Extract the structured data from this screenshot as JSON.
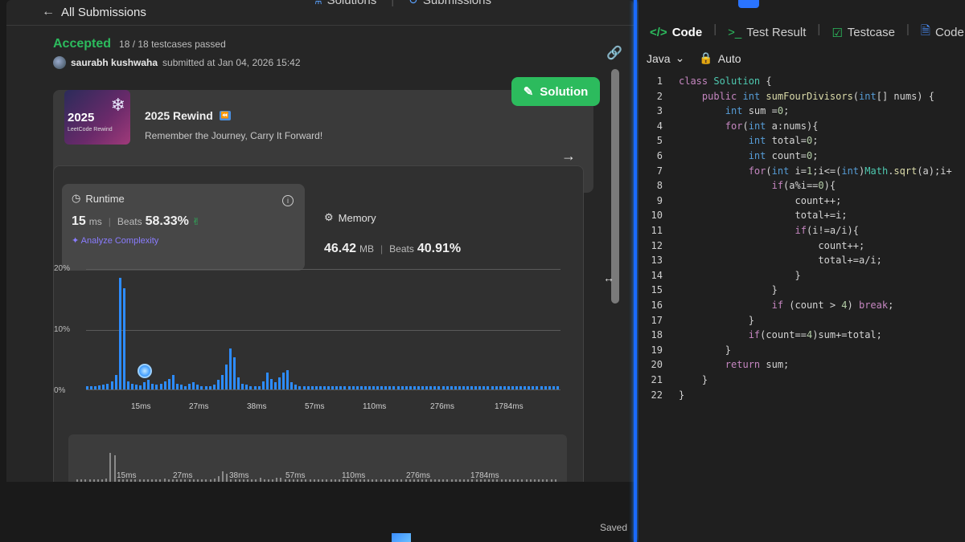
{
  "header": {
    "back_label": "All Submissions",
    "tabs": [
      {
        "label": "Solutions",
        "icon": "flask-icon"
      },
      {
        "label": "Submissions",
        "icon": "history-icon"
      }
    ]
  },
  "submission": {
    "status": "Accepted",
    "testcases": "18 / 18 testcases passed",
    "user": "saurabh kushwaha",
    "submitted_text": "submitted at Jan 04, 2026 15:42",
    "solution_button": "Solution"
  },
  "rewind": {
    "thumb_year": "2025",
    "thumb_sub": "LeetCode Rewind",
    "title": "2025 Rewind",
    "description": "Remember the Journey, Carry It Forward!"
  },
  "runtime": {
    "heading": "Runtime",
    "value": "15",
    "unit": "ms",
    "beats_label": "Beats",
    "beats_value": "58.33%",
    "analyze": "Analyze Complexity"
  },
  "memory": {
    "heading": "Memory",
    "value": "46.42",
    "unit": "MB",
    "beats_label": "Beats",
    "beats_value": "40.91%"
  },
  "chart_data": {
    "type": "bar",
    "title": "",
    "xlabel": "",
    "ylabel": "",
    "ylim": [
      0,
      20
    ],
    "y_ticks": [
      "20%",
      "10%",
      "0%"
    ],
    "x_ticks": [
      "15ms",
      "27ms",
      "38ms",
      "57ms",
      "110ms",
      "276ms",
      "1784ms"
    ],
    "values": [
      0.5,
      0.6,
      0.6,
      0.7,
      0.8,
      1.0,
      1.4,
      2.4,
      18.5,
      16.8,
      1.4,
      1.0,
      0.8,
      0.7,
      1.2,
      1.6,
      1.0,
      0.8,
      1.0,
      1.4,
      1.8,
      2.4,
      1.0,
      0.8,
      0.6,
      0.9,
      1.2,
      0.8,
      0.6,
      0.5,
      0.6,
      0.8,
      1.6,
      2.4,
      4.2,
      6.8,
      5.4,
      2.0,
      1.0,
      0.8,
      0.6,
      0.5,
      0.6,
      1.4,
      2.8,
      1.8,
      1.2,
      2.0,
      2.8,
      3.2,
      1.2,
      0.8,
      0.6,
      0.5,
      0.5,
      0.5,
      0.5,
      0.5,
      0.5,
      0.5,
      0.5,
      0.5,
      0.5,
      0.5,
      0.5,
      0.5,
      0.5,
      0.5,
      0.5,
      0.5,
      0.5,
      0.5,
      0.5,
      0.5,
      0.5,
      0.5,
      0.5,
      0.5,
      0.5,
      0.5,
      0.5,
      0.5,
      0.5,
      0.5,
      0.5,
      0.5,
      0.5,
      0.5,
      0.5,
      0.5,
      0.5,
      0.5,
      0.5,
      0.5,
      0.5,
      0.5,
      0.5,
      0.5,
      0.5,
      0.5,
      0.5,
      0.5,
      0.5,
      0.5,
      0.5,
      0.5,
      0.5,
      0.5,
      0.5,
      0.5,
      0.5,
      0.5,
      0.5,
      0.5,
      0.5,
      0.5
    ],
    "highlight_index": 15
  },
  "overview": {
    "ticks": [
      "15ms",
      "27ms",
      "38ms",
      "57ms",
      "110ms",
      "276ms",
      "1784ms"
    ]
  },
  "editor": {
    "tabs": [
      {
        "label": "Code",
        "icon": "code-icon"
      },
      {
        "label": "Test Result",
        "icon": "terminal-icon"
      },
      {
        "label": "Testcase",
        "icon": "checkbox-icon"
      },
      {
        "label": "Code Sample",
        "icon": "doc-icon"
      }
    ],
    "language": "Java",
    "mode": "Auto",
    "saved": "Saved",
    "line_numbers": [
      "1",
      "2",
      "3",
      "4",
      "5",
      "6",
      "7",
      "8",
      "9",
      "10",
      "11",
      "12",
      "13",
      "14",
      "15",
      "16",
      "17",
      "18",
      "19",
      "20",
      "21",
      "22"
    ],
    "lines": [
      "class Solution {",
      "    public int sumFourDivisors(int[] nums) {",
      "        int sum =0;",
      "        for(int a:nums){",
      "            int total=0;",
      "            int count=0;",
      "            for(int i=1;i<=(int)Math.sqrt(a);i+",
      "                if(a%i==0){",
      "                    count++;",
      "                    total+=i;",
      "                    if(i!=a/i){",
      "                        count++;",
      "                        total+=a/i;",
      "                    }",
      "                }",
      "                if (count > 4) break;",
      "            }",
      "            if(count==4)sum+=total;",
      "        }",
      "        return sum;",
      "    }",
      "}"
    ]
  }
}
